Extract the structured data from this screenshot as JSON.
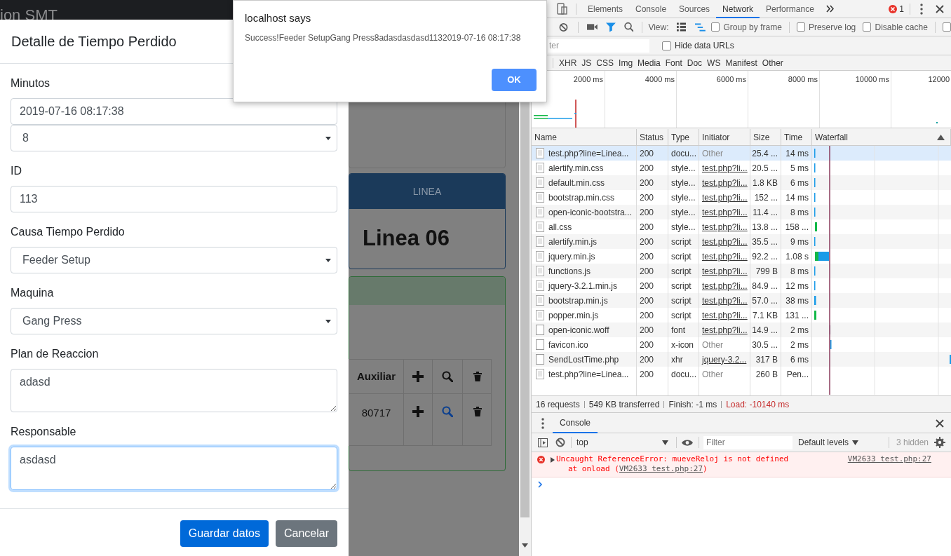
{
  "page": {
    "navbar_title": "ion SMT",
    "line_card": {
      "header": "LINEA",
      "name": "Linea 06"
    },
    "table": {
      "header": {
        "column_1": "Auxiliar"
      },
      "row": {
        "column_1": "80717"
      }
    }
  },
  "modal": {
    "title": "Detalle de Tiempo Perdido",
    "fields": [
      {
        "kind": "input",
        "label": "Minutos",
        "value": "2019-07-16 08:17:38",
        "focused": false
      },
      {
        "kind": "select",
        "value": "8",
        "focused": false
      },
      {
        "kind": "input",
        "label": "ID",
        "value": "113",
        "focused": false
      },
      {
        "kind": "select",
        "label": "Causa Tiempo Perdido",
        "value": "Feeder Setup",
        "focused": false
      },
      {
        "kind": "select",
        "label": "Maquina",
        "value": "Gang Press",
        "focused": false
      },
      {
        "kind": "textarea",
        "label": "Plan de Reaccion",
        "value": "adasd",
        "focused": false
      },
      {
        "kind": "textarea",
        "label": "Responsable",
        "value": "asdasd",
        "focused": true
      }
    ],
    "buttons": [
      {
        "label": "Guardar datos",
        "kind": "primary"
      },
      {
        "label": "Cancelar",
        "kind": "secondary"
      }
    ]
  },
  "alert": {
    "title": "localhost says",
    "message": "Success!Feeder SetupGang Press8adasdasdasd1132019-07-16 08:17:38",
    "button": "OK"
  },
  "devtools": {
    "tabs": [
      {
        "label": "Elements",
        "selected": false
      },
      {
        "label": "Console",
        "selected": false
      },
      {
        "label": "Sources",
        "selected": false
      },
      {
        "label": "Network",
        "selected": true
      },
      {
        "label": "Performance",
        "selected": false
      }
    ],
    "error_count": "1",
    "network_toolbar": {
      "view_label": "View:",
      "checkboxes": [
        {
          "label": "Group by frame",
          "checked": false
        },
        {
          "label": "Preserve log",
          "checked": false
        },
        {
          "label": "Disable cache",
          "checked": false
        },
        {
          "checked": false
        }
      ]
    },
    "filter": {
      "placeholder": "ter",
      "hide_data_urls": {
        "label": "Hide data URLs",
        "checked": false
      }
    },
    "type_filters": [
      "XHR",
      "JS",
      "CSS",
      "Img",
      "Media",
      "Font",
      "Doc",
      "WS",
      "Manifest",
      "Other"
    ],
    "overview_ticks": [
      "2000 ms",
      "4000 ms",
      "6000 ms",
      "8000 ms",
      "10000 ms",
      "12000"
    ],
    "columns": [
      "Name",
      "Status",
      "Type",
      "Initiator",
      "Size",
      "Time",
      "Waterfall"
    ],
    "rows": [
      {
        "kind": "document",
        "name": "test.php?line=Linea...",
        "status": "200",
        "type": "docu...",
        "initiator": "Other",
        "initiator_link": false,
        "size": "25.4 ...",
        "time": "14 ms",
        "selected": true
      },
      {
        "kind": "document",
        "name": "alertify.min.css",
        "status": "200",
        "type": "style...",
        "initiator": "test.php?li...",
        "initiator_link": true,
        "size": "20.5 ...",
        "time": "5 ms",
        "selected": false
      },
      {
        "kind": "document",
        "name": "default.min.css",
        "status": "200",
        "type": "style...",
        "initiator": "test.php?li...",
        "initiator_link": true,
        "size": "1.8 KB",
        "time": "6 ms",
        "selected": false
      },
      {
        "kind": "document",
        "name": "bootstrap.min.css",
        "status": "200",
        "type": "style...",
        "initiator": "test.php?li...",
        "initiator_link": true,
        "size": "152 ...",
        "time": "14 ms",
        "selected": false
      },
      {
        "kind": "document",
        "name": "open-iconic-bootstra...",
        "status": "200",
        "type": "style...",
        "initiator": "test.php?li...",
        "initiator_link": true,
        "size": "11.4 ...",
        "time": "8 ms",
        "selected": false
      },
      {
        "kind": "document",
        "name": "all.css",
        "status": "200",
        "type": "style...",
        "initiator": "test.php?li...",
        "initiator_link": true,
        "size": "13.8 ...",
        "time": "158 ...",
        "selected": false
      },
      {
        "kind": "document",
        "name": "alertify.min.js",
        "status": "200",
        "type": "script",
        "initiator": "test.php?li...",
        "initiator_link": true,
        "size": "35.5 ...",
        "time": "9 ms",
        "selected": false
      },
      {
        "kind": "document",
        "name": "jquery.min.js",
        "status": "200",
        "type": "script",
        "initiator": "test.php?li...",
        "initiator_link": true,
        "size": "92.2 ...",
        "time": "1.08 s",
        "selected": false
      },
      {
        "kind": "document",
        "name": "functions.js",
        "status": "200",
        "type": "script",
        "initiator": "test.php?li...",
        "initiator_link": true,
        "size": "799 B",
        "time": "8 ms",
        "selected": false
      },
      {
        "kind": "document",
        "name": "jquery-3.2.1.min.js",
        "status": "200",
        "type": "script",
        "initiator": "test.php?li...",
        "initiator_link": true,
        "size": "84.9 ...",
        "time": "12 ms",
        "selected": false
      },
      {
        "kind": "document",
        "name": "bootstrap.min.js",
        "status": "200",
        "type": "script",
        "initiator": "test.php?li...",
        "initiator_link": true,
        "size": "57.0 ...",
        "time": "38 ms",
        "selected": false
      },
      {
        "kind": "document",
        "name": "popper.min.js",
        "status": "200",
        "type": "script",
        "initiator": "test.php?li...",
        "initiator_link": true,
        "size": "7.1 KB",
        "time": "131 ...",
        "selected": false
      },
      {
        "kind": "blank",
        "name": "open-iconic.woff",
        "status": "200",
        "type": "font",
        "initiator": "test.php?li...",
        "initiator_link": true,
        "size": "14.9 ...",
        "time": "2 ms",
        "selected": false
      },
      {
        "kind": "blank",
        "name": "favicon.ico",
        "status": "200",
        "type": "x-icon",
        "initiator": "Other",
        "initiator_link": false,
        "size": "30.5 ...",
        "time": "2 ms",
        "selected": false
      },
      {
        "kind": "blank",
        "name": "SendLostTime.php",
        "status": "200",
        "type": "xhr",
        "initiator": "jquery-3.2...",
        "initiator_link": true,
        "size": "317 B",
        "time": "6 ms",
        "selected": false
      },
      {
        "kind": "document",
        "name": "test.php?line=Linea...",
        "status": "200",
        "type": "docu...",
        "initiator": "Other",
        "initiator_link": false,
        "size": "260 B",
        "time": "Pen...",
        "selected": false
      }
    ],
    "summary": [
      {
        "text": "16 requests",
        "kind": "normal"
      },
      {
        "text": "549 KB transferred",
        "kind": "normal"
      },
      {
        "text": "Finish: -1 ms",
        "kind": "normal"
      },
      {
        "text": "Load: -10140 ms",
        "kind": "load"
      }
    ],
    "drawer": {
      "tab": "Console",
      "context": "top",
      "filter_placeholder": "Filter",
      "levels": "Default levels",
      "hidden_count": "3 hidden",
      "messages": [
        {
          "kind": "error",
          "text": "Uncaught ReferenceError: mueveReloj is not defined",
          "stack_prefix": "at onload (",
          "stack_link": "VM2633 test.php:27",
          "stack_suffix": ")",
          "source": "VM2633 test.php:27"
        }
      ]
    }
  }
}
